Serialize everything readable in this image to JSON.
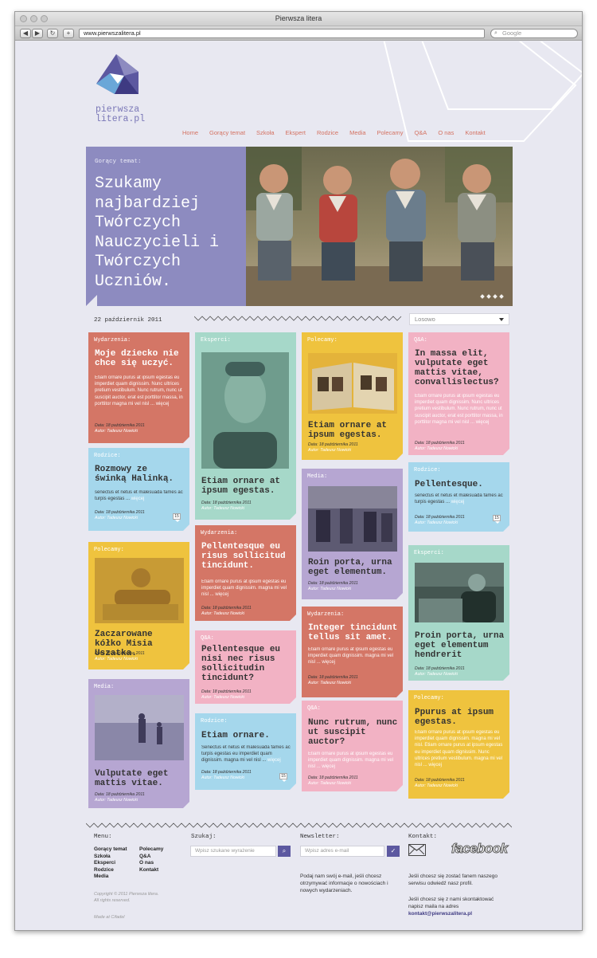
{
  "browser": {
    "window_title": "Pierwsza litera",
    "url": "www.pierwszalitera.pl",
    "search_placeholder": "Google",
    "back": "◀",
    "forward": "▶",
    "reload": "↻",
    "add": "+"
  },
  "logo": {
    "line1": "pierwsza",
    "line2": "litera.pl"
  },
  "nav": [
    "Home",
    "Gorący temat",
    "Szkoła",
    "Ekspert",
    "Rodzice",
    "Media",
    "Polecamy",
    "Q&A",
    "O nas",
    "Kontakt"
  ],
  "hero": {
    "label": "Gorący temat:",
    "title": "Szukamy najbardziej Twórczych Nauczycieli i Twórczych Uczniów."
  },
  "date": "22 październik 2011",
  "sort_select": "Losowo",
  "cards": [
    {
      "cat": "Wydarzenia:",
      "title": "Moje dziecko nie chce się uczyć.",
      "text": "Etiam ornare purus at ipsum egestas eu imperdiet quam dignissim. Nunc ultrices pretium vestibulum. Nunc rutrum, nunc ut suscipit auctor, erat est porttitor massa, in porttitor magna mi vel nisl ...",
      "more": "więcej",
      "date": "Data: 18 października 2011",
      "author": "Autor: Tadeusz Nowicki"
    },
    {
      "cat": "Rodzice:",
      "title": "Rozmowy ze świnką Halinką.",
      "text": "senectus et netus et malesuada fames ac turpis egestas ...",
      "more": "więcej",
      "date": "Data: 18 października 2011",
      "author": "Autor: Tadeusz Nowicki",
      "comments": "15"
    },
    {
      "cat": "Polecamy:",
      "title": "Zaczarowane kółko Misia Uszatka.",
      "date": "Data: 18 października 2011",
      "author": "Autor: Tadeusz Nowicki"
    },
    {
      "cat": "Media:",
      "title": "Vulputate eget mattis vitae.",
      "date": "Data: 18 października 2011",
      "author": "Autor: Tadeusz Nowicki"
    },
    {
      "cat": "Eksperci:",
      "title": "Etiam ornare at ipsum egestas.",
      "date": "Data: 18 października 2011",
      "author": "Autor: Tadeusz Nowicki"
    },
    {
      "cat": "Wydarzenia:",
      "title": "Pellentesque eu risus sollicitud tincidunt.",
      "text": "Etiam ornare purus at ipsum egestas eu imperdiet quam dignissim. magna mi vel nisl ...",
      "more": "więcej",
      "date": "Data: 18 października 2011",
      "author": "Autor: Tadeusz Nowicki"
    },
    {
      "cat": "Q&A:",
      "title": "Pellentesque eu nisi nec risus sollicitudin tincidunt?",
      "date": "Data: 18 października 2011",
      "author": "Autor: Tadeusz Nowicki"
    },
    {
      "cat": "Rodzice:",
      "title": "Etiam ornare.",
      "text": "Senectus et netus et malesuada fames ac turpis egestas eu imperdiet quam dignissim. magna mi vel nisl ...",
      "more": "więcej",
      "date": "Data: 18 października 2011",
      "author": "Autor: Tadeusz Nowicki",
      "comments": "15"
    },
    {
      "cat": "Polecamy:",
      "title": "Etiam ornare at ipsum egestas.",
      "date": "Data: 18 października 2011",
      "author": "Autor: Tadeusz Nowicki"
    },
    {
      "cat": "Media:",
      "title": "Roin porta, urna eget elementum.",
      "date": "Data: 18 października 2011",
      "author": "Autor: Tadeusz Nowicki"
    },
    {
      "cat": "Wydarzenia:",
      "title": "Integer tincidunt tellus sit amet.",
      "text": "Etiam ornare purus at ipsum egestas eu imperdiet quam dignissim. magna mi vel nisl ...",
      "more": "więcej",
      "date": "Data: 18 października 2011",
      "author": "Autor: Tadeusz Nowicki"
    },
    {
      "cat": "Q&A:",
      "title": "Nunc rutrum, nunc ut suscipit auctor?",
      "text": "Etiam ornare purus at ipsum egestas eu imperdiet quam dignissim. magna mi vel nisl ...",
      "more": "więcej",
      "date": "Data: 18 października 2011",
      "author": "Autor: Tadeusz Nowicki"
    },
    {
      "cat": "Q&A:",
      "title": "In massa elit, vulputate eget mattis vitae, convallislectus?",
      "text": "Etiam ornare purus at ipsum egestas eu imperdiet quam dignissim. Nunc ultrices pretium vestibulum. Nunc rutrum, nunc ut suscipit auctor, erat est porttitor massa, in porttitor magna mi vel nisl ...",
      "more": "więcej",
      "date": "Data: 18 października 2011",
      "author": "Autor: Tadeusz Nowicki"
    },
    {
      "cat": "Rodzice:",
      "title": "Pellentesque.",
      "text": "senectus et netus et malesuada fames ac turpis egestas ...",
      "more": "więcej",
      "date": "Data: 18 października 2011",
      "author": "Autor: Tadeusz Nowicki",
      "comments": "15"
    },
    {
      "cat": "Eksperci:",
      "title": "Proin porta, urna eget elementum hendrerit",
      "date": "Data: 18 października 2011",
      "author": "Autor: Tadeusz Nowicki"
    },
    {
      "cat": "Polecamy:",
      "title": "Ppurus at ipsum egestas.",
      "text": "Etiam ornare purus at ipsum egestas eu imperdiet quam dignissim. magna mi vel nisl. Etiam ornare purus at ipsum egestas eu imperdiet quam dignissim. Nunc ultrices pretium vestibulum. magna mi vel nisl ...",
      "more": "więcej",
      "date": "Data: 18 października 2011",
      "author": "Autor: Tadeusz Nowicki"
    }
  ],
  "footer": {
    "menu_title": "Menu:",
    "menu_col1": [
      "Gorący temat",
      "Szkoła",
      "Eksperci",
      "Rodzice",
      "Media"
    ],
    "menu_col2": [
      "Polecamy",
      "Q&A",
      "O nas",
      "Kontakt"
    ],
    "search_title": "Szukaj:",
    "search_placeholder": "Wpisz szukane wyrażenie",
    "newsletter_title": "Newsletter:",
    "newsletter_placeholder": "Wpisz adres e-mail",
    "newsletter_text": "Podaj nam swój e-mail, jeśli chcesz otrzymywać informacje o nowościach i nowych wydarzeniach.",
    "contact_title": "Kontakt:",
    "facebook": "facebook",
    "contact_text1": "Jeśli chcesz się zostać fanem naszego serwisu odwiedź nasz profil.",
    "contact_text2": "Jeśli chcesz się z nami skontaktować napisz maila na adres",
    "contact_email": "kontakt@pierwszalitera.pl",
    "copyright1": "Copyright © 2011 Pierwsza litera.",
    "copyright2": "All rights reserved.",
    "made_by": "Made at Cifadel"
  },
  "colors": {
    "coral": "#d47666",
    "mint": "#a6d8c9",
    "yellow": "#efc33e",
    "pink": "#f2b2c4",
    "blue": "#a5d7ec",
    "purple": "#b6a6d2",
    "hero_purple": "#8d8bc0",
    "accent": "#5c58a0"
  }
}
